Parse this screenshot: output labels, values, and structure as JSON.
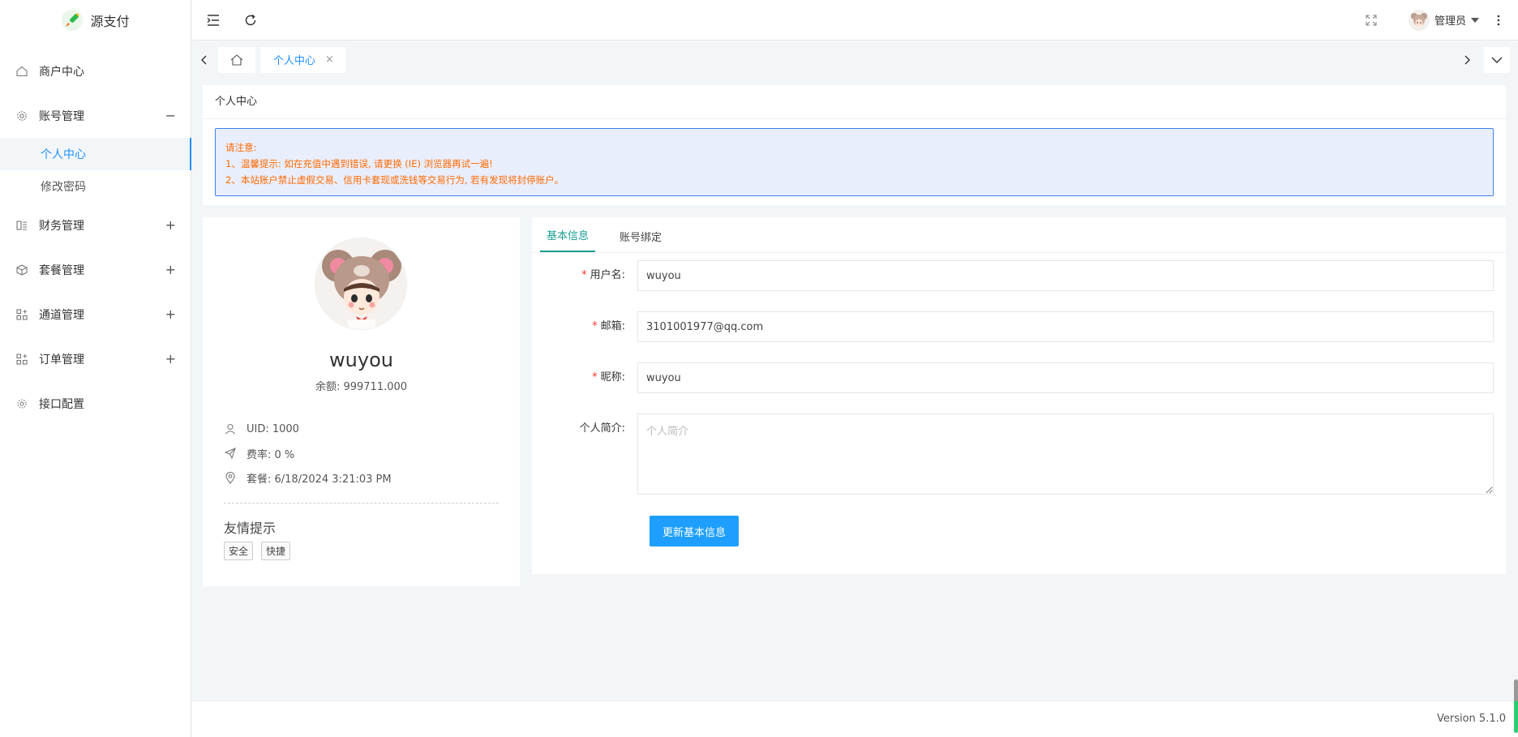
{
  "brand": {
    "name": "源支付"
  },
  "sidebar": {
    "items": [
      {
        "label": "商户中心",
        "toggle": ""
      },
      {
        "label": "账号管理",
        "toggle": "−"
      },
      {
        "label": "财务管理",
        "toggle": "+"
      },
      {
        "label": "套餐管理",
        "toggle": "+"
      },
      {
        "label": "通道管理",
        "toggle": "+"
      },
      {
        "label": "订单管理",
        "toggle": "+"
      },
      {
        "label": "接口配置",
        "toggle": ""
      }
    ],
    "submenu": [
      {
        "label": "个人中心",
        "active": true
      },
      {
        "label": "修改密码",
        "active": false
      }
    ]
  },
  "header": {
    "user_label": "管理员"
  },
  "tabs": {
    "current": "个人中心",
    "close": "×"
  },
  "notice": {
    "title": "个人中心",
    "lines": [
      "请注意:",
      "1、温馨提示: 如在充值中遇到错误, 请更换 (IE) 浏览器再试一遍!",
      "2、本站账户禁止虚假交易、信用卡套现或洗钱等交易行为, 若有发现将封停账户。"
    ]
  },
  "profile": {
    "name": "wuyou",
    "balance": "余额: 999711.000",
    "uid": "UID: 1000",
    "rate": "费率: 0 %",
    "plan": "套餐: 6/18/2024 3:21:03 PM",
    "tip_title": "友情提示",
    "tags": [
      "安全",
      "快捷"
    ]
  },
  "form": {
    "tabs": [
      {
        "label": "基本信息",
        "active": true
      },
      {
        "label": "账号绑定",
        "active": false
      }
    ],
    "username": {
      "label": "用户名:",
      "value": "wuyou"
    },
    "email": {
      "label": "邮箱:",
      "value": "3101001977@qq.com"
    },
    "nickname": {
      "label": "昵称:",
      "value": "wuyou"
    },
    "bio": {
      "label": "个人简介:",
      "placeholder": "个人简介"
    },
    "submit_label": "更新基本信息"
  },
  "footer": {
    "version": "Version 5.1.0"
  },
  "colors": {
    "accent": "#1e9fff",
    "tab_active": "#1aa094",
    "notice_text": "#ff6a00",
    "notice_bg": "#e9eefc"
  }
}
